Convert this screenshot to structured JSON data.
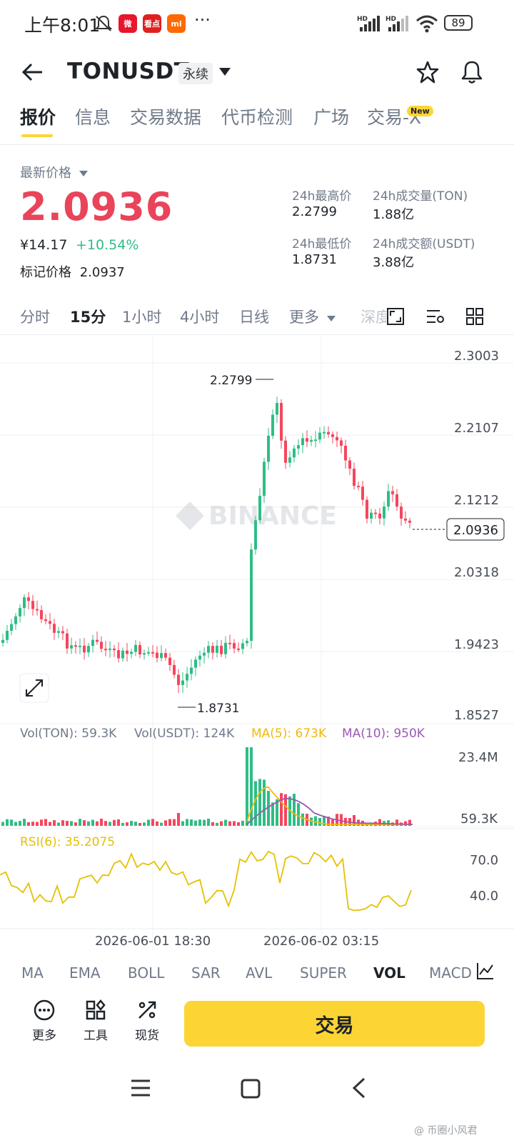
{
  "status_bar": {
    "time": "上午8:01",
    "apps": [
      {
        "icon": "weibo-icon",
        "color": "#e6162d",
        "label": "微"
      },
      {
        "icon": "news-icon",
        "color": "#e02020",
        "label": "看点"
      },
      {
        "icon": "mi-icon",
        "color": "#ff6900",
        "label": "mi"
      }
    ],
    "more": "···",
    "signal1": "HD",
    "signal2": "HD",
    "battery": "89"
  },
  "header": {
    "symbol": "TONUSDT",
    "contract_type": "永续"
  },
  "tabs": [
    "报价",
    "信息",
    "交易数据",
    "代币检测",
    "广场",
    "交易-X"
  ],
  "tab_badge": "New",
  "price": {
    "label": "最新价格",
    "last": "2.0936",
    "cny": "¥14.17",
    "change": "+10.54%",
    "mark_label": "标记价格",
    "mark": "2.0937"
  },
  "stats": {
    "high_label": "24h最高价",
    "high": "2.2799",
    "low_label": "24h最低价",
    "low": "1.8731",
    "vol_label": "24h成交量(TON)",
    "vol": "1.88亿",
    "amount_label": "24h成交额(USDT)",
    "amount": "3.88亿"
  },
  "intervals": [
    "分时",
    "15分",
    "1小时",
    "4小时",
    "日线",
    "更多",
    "深度"
  ],
  "active_interval": "15分",
  "chart": {
    "watermark": "BINANCE",
    "price_axis": [
      "2.3003",
      "2.2107",
      "2.1212",
      "2.0318",
      "1.9423",
      "1.8527"
    ],
    "high_marker": "2.2799",
    "low_marker": "1.8731",
    "current_price": "2.0936",
    "vol_legend": {
      "vol_ton": "Vol(TON): 59.3K",
      "vol_usdt": "Vol(USDT): 124K",
      "ma5": "MA(5): 673K",
      "ma10": "MA(10): 950K"
    },
    "vol_axis": [
      "23.4M",
      "59.3K"
    ],
    "rsi_legend": "RSI(6): 35.2075",
    "rsi_axis": [
      "70.0",
      "40.0"
    ],
    "time_axis": [
      "2026-06-01 18:30",
      "2026-06-02 03:15"
    ],
    "colors": {
      "up": "#2ebd85",
      "down": "#f6465d",
      "ma5": "#f0b90b",
      "ma10": "#9b59b6",
      "rsi": "#e5c100"
    }
  },
  "indicators": [
    "MA",
    "EMA",
    "BOLL",
    "SAR",
    "AVL",
    "SUPER",
    "VOL",
    "MACD"
  ],
  "active_indicator": "VOL",
  "bottom_tools": [
    "更多",
    "工具",
    "现货"
  ],
  "trade_button": "交易",
  "footer_watermark": "@ 币圈小风君"
}
